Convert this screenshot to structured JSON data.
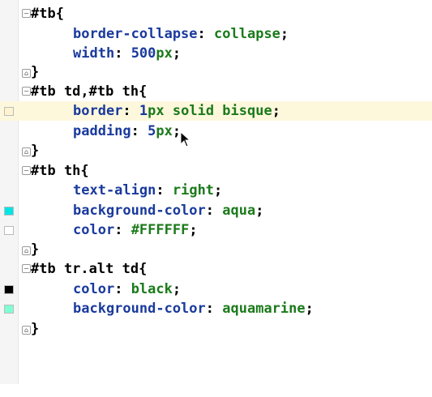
{
  "editor": {
    "blocks": [
      {
        "selector": "#tb",
        "open": "{",
        "close": "}",
        "declarations": [
          {
            "property": "border-collapse",
            "value": "collapse"
          },
          {
            "property": "width",
            "number": "500",
            "unit": "px"
          }
        ]
      },
      {
        "selector": "#tb td,#tb th",
        "open": "{",
        "close": "}",
        "declarations": [
          {
            "property": "border",
            "number": "1",
            "value": "px solid bisque"
          },
          {
            "property": "padding",
            "number": "5",
            "unit": "px"
          }
        ]
      },
      {
        "selector": "#tb th",
        "open": "{",
        "close": "}",
        "declarations": [
          {
            "property": "text-align",
            "value": "right"
          },
          {
            "property": "background-color",
            "value": "aqua",
            "swatch": "#00e5e5"
          },
          {
            "property": "color",
            "value": "#FFFFFF",
            "swatch": "#ffffff"
          }
        ]
      },
      {
        "selector": "#tb tr.alt td",
        "open": "{",
        "close": "}",
        "declarations": [
          {
            "property": "color",
            "value": "black",
            "swatch": "#000000"
          },
          {
            "property": "background-color",
            "value": "aquamarine",
            "swatch": "#7fffd4"
          }
        ]
      }
    ],
    "colon": ":",
    "semicolon": ";",
    "colors": {
      "property": "#1a3a9c",
      "value": "#1b7a1b",
      "current_line": "#fdf8dc"
    }
  }
}
